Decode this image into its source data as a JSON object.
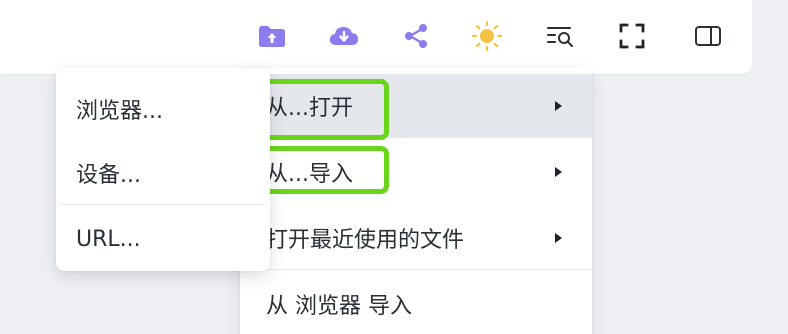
{
  "toolbar": {
    "buttons": [
      {
        "name": "upload-folder-icon",
        "color": "#8b7cf0"
      },
      {
        "name": "cloud-download-icon",
        "color": "#8b7cf0"
      },
      {
        "name": "share-icon",
        "color": "#8b7cf0"
      },
      {
        "name": "sun-icon",
        "color": "#f6c445"
      },
      {
        "name": "search-list-icon",
        "color": "#2b2f36"
      },
      {
        "name": "fullscreen-icon",
        "color": "#1f2329"
      },
      {
        "name": "sidebar-panel-icon",
        "color": "#2b2f36"
      }
    ]
  },
  "menu": {
    "items": [
      {
        "label": "从...打开",
        "has_submenu": true,
        "highlighted": true
      },
      {
        "label": "从...导入",
        "has_submenu": true,
        "highlighted": false
      },
      {
        "label": "打开最近使用的文件",
        "has_submenu": true,
        "highlighted": false
      },
      {
        "label": "从 浏览器 导入",
        "has_submenu": false,
        "highlighted": false
      }
    ]
  },
  "submenu": {
    "items": [
      {
        "label": "浏览器..."
      },
      {
        "label": "设备..."
      },
      {
        "label": "URL..."
      }
    ]
  },
  "colors": {
    "accent": "#8b7cf0",
    "highlight_box": "#6bd51b",
    "hover_bg": "#e4e7ec",
    "background": "#eef0f4"
  }
}
